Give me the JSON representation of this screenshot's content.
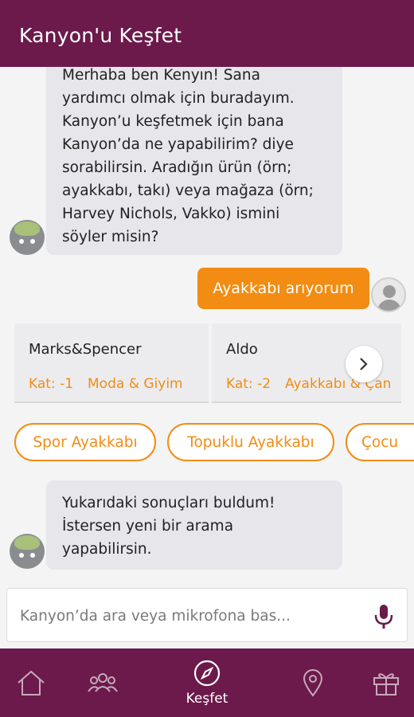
{
  "header": {
    "title": "Kanyon'u Keşfet"
  },
  "chat": {
    "bot_message_1": "Merhaba ben Kenyın! Sana yardımcı olmak için buradayım. Kanyon’u keşfetmek için bana Kanyon’da ne yapabilirim? diye sorabilirsin. Aradığın ürün (örn; ayakkabı, takı) veya mağaza (örn; Harvey Nichols, Vakko) ismini söyler misin?",
    "bot_message_1_lines": [
      "Merhaba ben Kenyın! Sana",
      "yardımcı olmak için buradayım.",
      "Kanyon’u keşfetmek için bana",
      "Kanyon’da ne yapabilirim? diye",
      "sorabilirsin. Aradığın ürün (örn;",
      "ayakkabı, takı) veya mağaza (örn;",
      "Harvey Nichols, Vakko) ismini",
      "söyler misin?"
    ],
    "user_message": "Ayakkabı arıyorum",
    "results": [
      {
        "name": "Marks&Spencer",
        "floor": "Kat: -1",
        "category": "Moda & Giyim"
      },
      {
        "name": "Aldo",
        "floor": "Kat: -2",
        "category": "Ayakkabı & Çan"
      }
    ],
    "chips": [
      "Spor Ayakkabı",
      "Topuklu Ayakkabı",
      "Çocu"
    ],
    "bot_message_2_lines": [
      "Yukarıdaki sonuçları buldum!",
      "İstersen yeni bir arama",
      "yapabilirsin."
    ]
  },
  "input": {
    "placeholder": "Kanyon’da ara veya mikrofona bas..."
  },
  "nav": {
    "active": "Keşfet",
    "items": [
      {
        "icon": "home-icon",
        "label": ""
      },
      {
        "icon": "people-icon",
        "label": ""
      },
      {
        "icon": "compass-icon",
        "label": "Keşfet"
      },
      {
        "icon": "location-pin-icon",
        "label": ""
      },
      {
        "icon": "gift-icon",
        "label": ""
      }
    ]
  },
  "colors": {
    "brand": "#6b1a4b",
    "accent": "#f28c13",
    "bubble": "#e6e6eb"
  }
}
